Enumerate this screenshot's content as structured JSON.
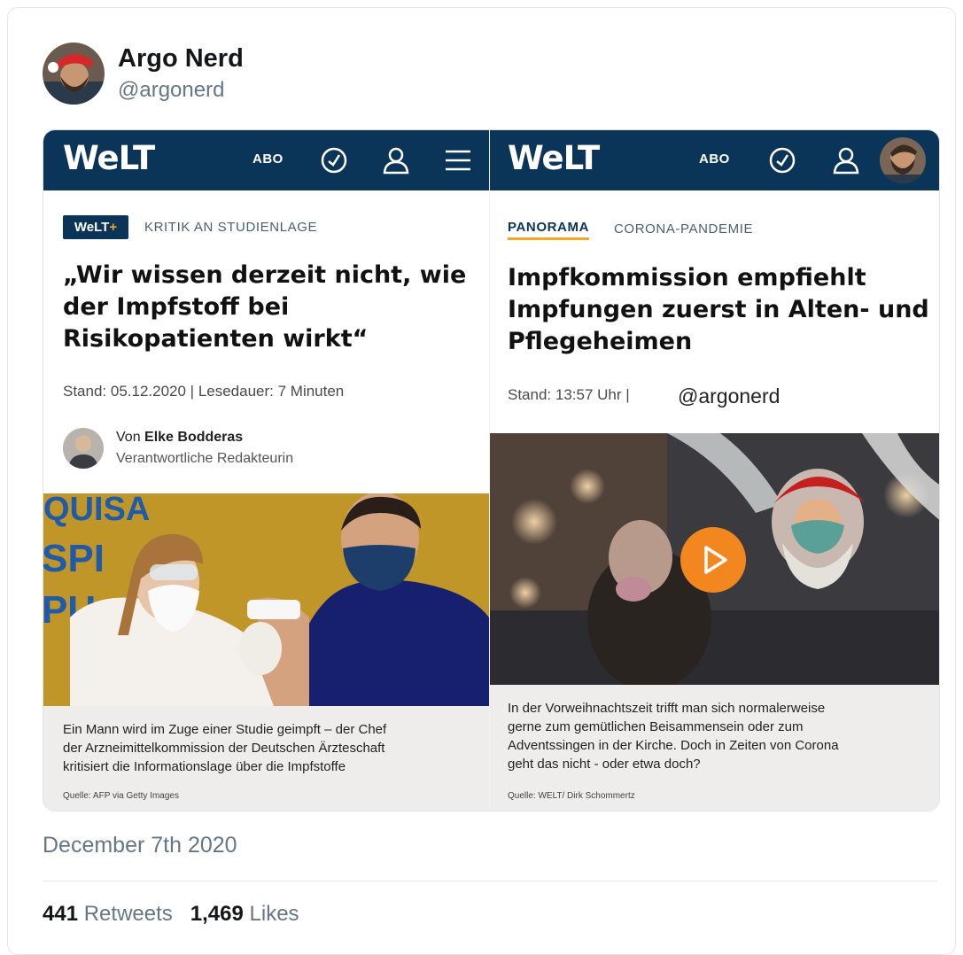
{
  "tweet": {
    "display_name": "Argo Nerd",
    "handle": "@argonerd",
    "date": "December 7th 2020",
    "retweets": "441",
    "retweets_label": "Retweets",
    "likes": "1,469",
    "likes_label": "Likes"
  },
  "left_article": {
    "logo": "WeLT",
    "abo": "ABO",
    "badge": "WeLT",
    "badge_plus": "+",
    "kicker": "KRITIK AN STUDIENLAGE",
    "headline_1": "„Wir wissen derzeit nicht, wie",
    "headline_2": "der Impfstoff bei",
    "headline_3": "Risikopatienten wirkt“",
    "stand": "Stand: 05.12.2020 | Lesedauer: 7 Minuten",
    "author_prefix": "Von ",
    "author_name": "Elke Bodderas",
    "author_role": "Verantwortliche Redakteurin",
    "photo_sign": "QUISA",
    "caption_1": "Ein Mann wird im Zuge einer Studie geimpft – der Chef",
    "caption_2": "der Arzneimittelkommission der Deutschen Ärzteschaft",
    "caption_3": "kritisiert die Informationslage über die Impfstoffe",
    "source": "Quelle: AFP via Getty Images"
  },
  "right_article": {
    "logo": "WeLT",
    "abo": "ABO",
    "section": "PANORAMA",
    "kicker": "CORONA-PANDEMIE",
    "headline_1": "Impfkommission empfiehlt",
    "headline_2": "Impfungen zuerst in Alten- und",
    "headline_3": "Pflegeheimen",
    "stand": "Stand: 13:57 Uhr  |",
    "watermark": "@argonerd",
    "caption_1": "In der Vorweihnachtszeit trifft man sich normalerweise",
    "caption_2": "gerne zum gemütlichen Beisammensein oder zum",
    "caption_3": "Adventssingen in der Kirche. Doch in Zeiten von Corona",
    "caption_4": "geht das nicht - oder etwa doch?",
    "source": "Quelle: WELT/ Dirk Schommertz"
  },
  "colors": {
    "welt_navy": "#0b3558",
    "play_orange": "#f2871f",
    "welt_plus": "#f5a623"
  },
  "icons": [
    "clock-icon",
    "user-icon",
    "menu-icon",
    "play-icon"
  ]
}
